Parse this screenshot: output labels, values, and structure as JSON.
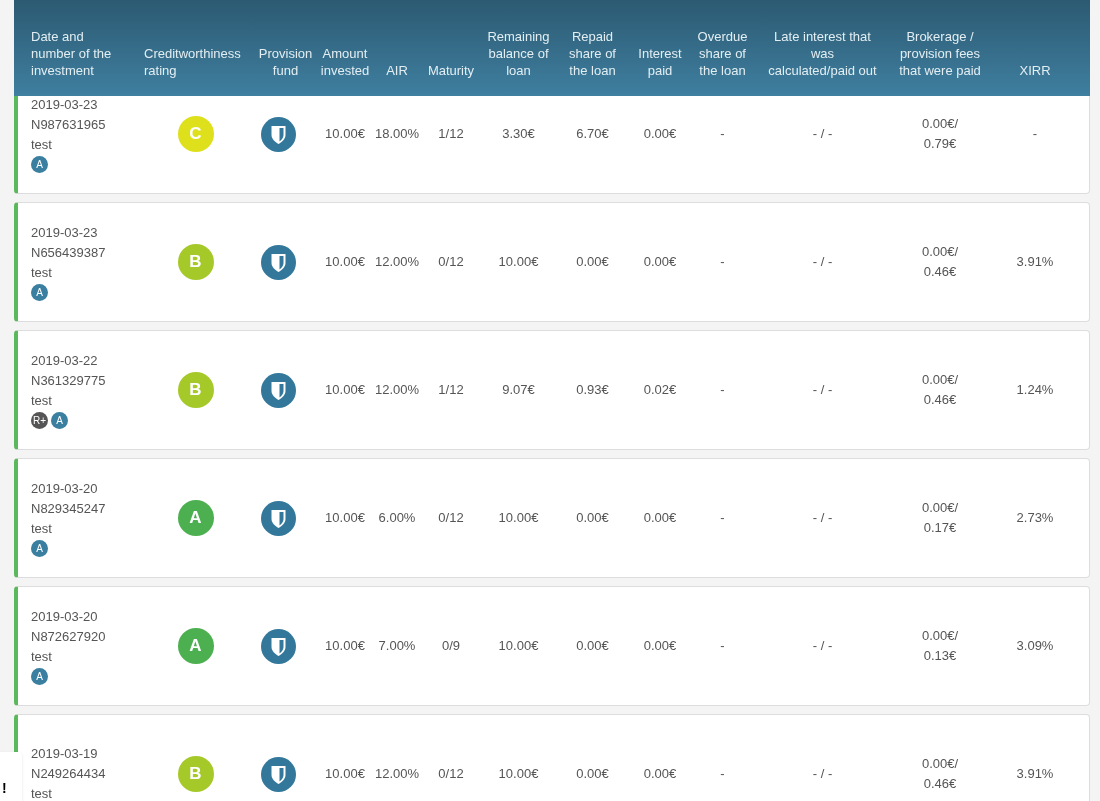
{
  "table": {
    "columns": [
      "Date and number of the investment",
      "Creditworthiness rating",
      "Provision fund",
      "Amount invested",
      "AIR",
      "Maturity",
      "Remaining balance of loan",
      "Repaid share of the loan",
      "Interest paid",
      "Overdue share of the loan",
      "Late interest that was calculated/paid out",
      "Brokerage / provision fees that were paid",
      "XIRR"
    ],
    "rows": [
      {
        "date": "2019-03-23",
        "number": "N987631965",
        "note": "test",
        "badges": [
          {
            "label": "A",
            "color": "#3a7fa0"
          }
        ],
        "rating": {
          "label": "C",
          "color": "#dfe01c"
        },
        "amount": "10.00€",
        "air": "18.00%",
        "maturity": "1/12",
        "remaining": "3.30€",
        "repaid": "6.70€",
        "interest": "0.00€",
        "overdue": "-",
        "late": "- / -",
        "brokerage": [
          "0.00€/",
          "0.79€"
        ],
        "xirr": "-"
      },
      {
        "date": "2019-03-23",
        "number": "N656439387",
        "note": "test",
        "badges": [
          {
            "label": "A",
            "color": "#3a7fa0"
          }
        ],
        "rating": {
          "label": "B",
          "color": "#a6c92a"
        },
        "amount": "10.00€",
        "air": "12.00%",
        "maturity": "0/12",
        "remaining": "10.00€",
        "repaid": "0.00€",
        "interest": "0.00€",
        "overdue": "-",
        "late": "- / -",
        "brokerage": [
          "0.00€/",
          "0.46€"
        ],
        "xirr": "3.91%"
      },
      {
        "date": "2019-03-22",
        "number": "N361329775",
        "note": "test",
        "badges": [
          {
            "label": "R+",
            "color": "#555555"
          },
          {
            "label": "A",
            "color": "#3a7fa0"
          }
        ],
        "rating": {
          "label": "B",
          "color": "#a6c92a"
        },
        "amount": "10.00€",
        "air": "12.00%",
        "maturity": "1/12",
        "remaining": "9.07€",
        "repaid": "0.93€",
        "interest": "0.02€",
        "overdue": "-",
        "late": "- / -",
        "brokerage": [
          "0.00€/",
          "0.46€"
        ],
        "xirr": "1.24%"
      },
      {
        "date": "2019-03-20",
        "number": "N829345247",
        "note": "test",
        "badges": [
          {
            "label": "A",
            "color": "#3a7fa0"
          }
        ],
        "rating": {
          "label": "A",
          "color": "#4caf50"
        },
        "amount": "10.00€",
        "air": "6.00%",
        "maturity": "0/12",
        "remaining": "10.00€",
        "repaid": "0.00€",
        "interest": "0.00€",
        "overdue": "-",
        "late": "- / -",
        "brokerage": [
          "0.00€/",
          "0.17€"
        ],
        "xirr": "2.73%"
      },
      {
        "date": "2019-03-20",
        "number": "N872627920",
        "note": "test",
        "badges": [
          {
            "label": "A",
            "color": "#3a7fa0"
          }
        ],
        "rating": {
          "label": "A",
          "color": "#4caf50"
        },
        "amount": "10.00€",
        "air": "7.00%",
        "maturity": "0/9",
        "remaining": "10.00€",
        "repaid": "0.00€",
        "interest": "0.00€",
        "overdue": "-",
        "late": "- / -",
        "brokerage": [
          "0.00€/",
          "0.13€"
        ],
        "xirr": "3.09%"
      },
      {
        "date": "2019-03-19",
        "number": "N249264434",
        "note": "test",
        "rating": {
          "label": "B",
          "color": "#a6c92a"
        },
        "amount": "10.00€",
        "air": "12.00%",
        "maturity": "0/12",
        "remaining": "10.00€",
        "repaid": "0.00€",
        "interest": "0.00€",
        "overdue": "-",
        "late": "- / -",
        "brokerage": [
          "0.00€/",
          "0.46€"
        ],
        "xirr": "3.91%"
      }
    ]
  },
  "feedback_tab": {
    "label": "!"
  }
}
